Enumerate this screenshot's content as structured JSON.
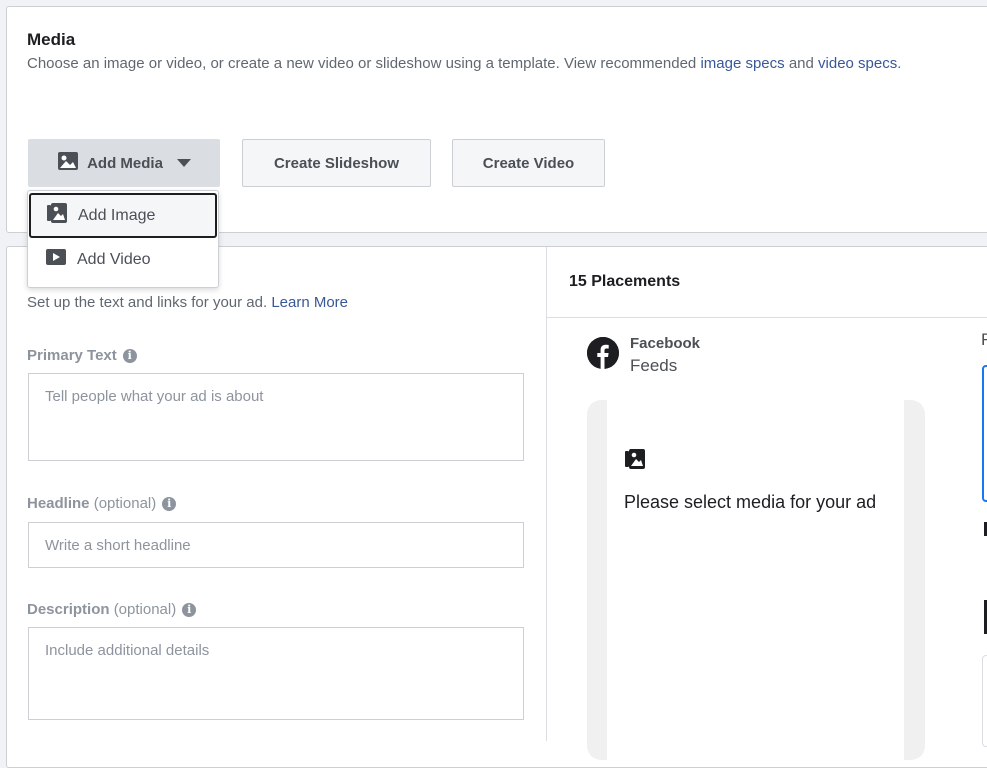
{
  "media": {
    "title": "Media",
    "desc_prefix": "Choose an image or video, or create a new video or slideshow using a template. View recommended ",
    "image_specs_link": "image specs",
    "desc_and": " and ",
    "video_specs_link": "video specs",
    "desc_suffix": ".",
    "add_media_label": "Add Media",
    "create_slideshow_label": "Create Slideshow",
    "create_video_label": "Create Video",
    "dropdown": {
      "add_image": "Add Image",
      "add_video": "Add Video"
    }
  },
  "text_section": {
    "setup_text": "Set up the text and links for your ad. ",
    "learn_more": "Learn More",
    "primary_text_label": "Primary Text",
    "primary_text_placeholder": "Tell people what your ad is about",
    "headline_label": "Headline",
    "headline_optional": "(optional)",
    "headline_placeholder": "Write a short headline",
    "description_label": "Description",
    "description_optional": "(optional)",
    "description_placeholder": "Include additional details"
  },
  "preview": {
    "placements_title": "15 Placements",
    "platform": "Facebook",
    "placement": "Feeds",
    "empty_message": "Please select media for your ad",
    "right_letter": "F"
  },
  "colors": {
    "link": "#385898",
    "accent_blue": "#1877f2"
  }
}
